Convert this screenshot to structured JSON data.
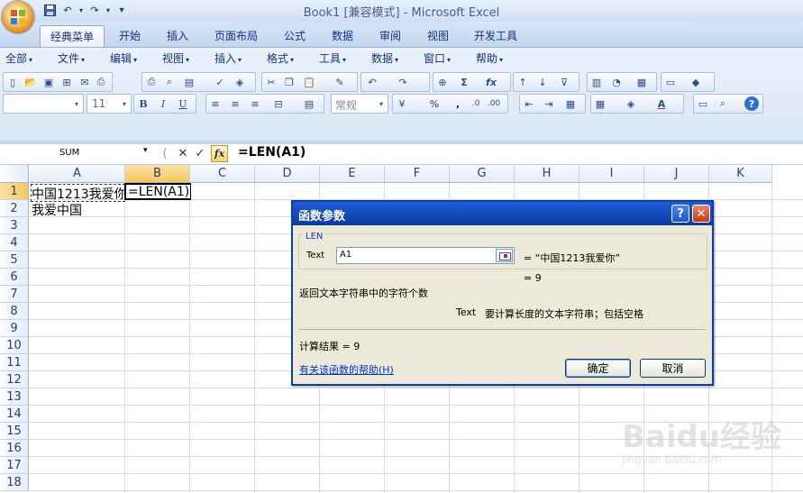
{
  "window": {
    "title": "Book1  [兼容模式] - Microsoft Excel"
  },
  "quick_access": [
    "save-icon",
    "undo-icon",
    "redo-icon",
    "customize-icon"
  ],
  "ribbon": {
    "tabs": [
      "经典菜单",
      "开始",
      "插入",
      "页面布局",
      "公式",
      "数据",
      "审阅",
      "视图",
      "开发工具"
    ],
    "active_tab": "经典菜单",
    "menus": [
      "全部",
      "文件",
      "编辑",
      "视图",
      "插入",
      "格式",
      "工具",
      "数据",
      "窗口",
      "帮助"
    ],
    "font_size": "11",
    "number_format": "常规",
    "percent": "%",
    "comma": ","
  },
  "formula_bar": {
    "name_box": "SUM",
    "formula": "=LEN(A1)",
    "fx": "fx"
  },
  "sheet": {
    "columns": [
      "A",
      "B",
      "C",
      "D",
      "E",
      "F",
      "G",
      "H",
      "I",
      "J",
      "K"
    ],
    "rows": [
      "1",
      "2",
      "3",
      "4",
      "5",
      "6",
      "7",
      "8",
      "9",
      "10",
      "11",
      "12",
      "13",
      "14",
      "15",
      "16",
      "17",
      "18"
    ],
    "cells": {
      "A1": "中国1213我爱你",
      "B1": "=LEN(A1)",
      "A2": "我爱中国"
    }
  },
  "dialog": {
    "title": "函数参数",
    "help_btn": "?",
    "close_btn": "✕",
    "function_name": "LEN",
    "arg_label": "Text",
    "arg_value": "A1",
    "arg_result": "= “中国1213我爱你”",
    "func_result": "= 9",
    "description": "返回文本字符串中的字符个数",
    "arg_desc_name": "Text",
    "arg_desc": "要计算长度的文本字符串；包括空格",
    "calc_result": "计算结果 =  9",
    "help_link": "有关该函数的帮助(H)",
    "ok": "确定",
    "cancel": "取消"
  },
  "watermark": {
    "text": "Baidu经验",
    "url": "jingyan.baidu.com"
  }
}
